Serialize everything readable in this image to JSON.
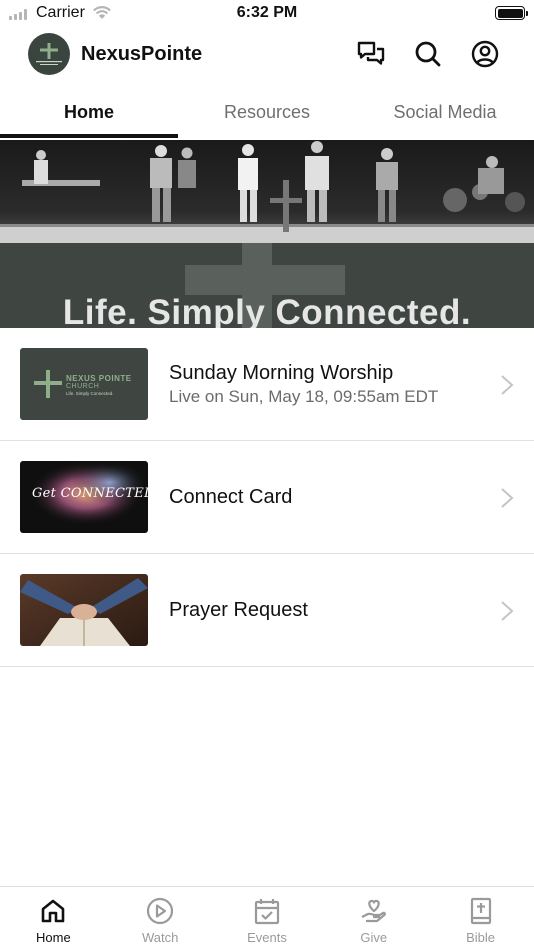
{
  "status_bar": {
    "carrier": "Carrier",
    "time": "6:32 PM"
  },
  "header": {
    "title": "NexusPointe",
    "logo_text": "NEXUS POINTE CHURCH"
  },
  "tabs": [
    {
      "label": "Home",
      "active": true
    },
    {
      "label": "Resources",
      "active": false
    },
    {
      "label": "Social Media",
      "active": false
    }
  ],
  "hero": {
    "tagline": "Life. Simply Connected."
  },
  "list": [
    {
      "title": "Sunday Morning Worship",
      "subtitle": "Live on Sun, May 18, 09:55am EDT",
      "thumb_text": "NEXUS POINTE",
      "thumb_text2": "CHURCH",
      "thumb_text3": "Life. Simply Connected."
    },
    {
      "title": "Connect Card",
      "thumb_text": "Get CONNECTED"
    },
    {
      "title": "Prayer Request"
    }
  ],
  "bottom_nav": [
    {
      "label": "Home",
      "icon": "home-icon",
      "active": true
    },
    {
      "label": "Watch",
      "icon": "play-circle-icon",
      "active": false
    },
    {
      "label": "Events",
      "icon": "calendar-check-icon",
      "active": false
    },
    {
      "label": "Give",
      "icon": "give-heart-hand-icon",
      "active": false
    },
    {
      "label": "Bible",
      "icon": "bible-icon",
      "active": false
    }
  ],
  "colors": {
    "accent": "#111111",
    "inactive": "#9a9a9a",
    "brand_green": "#3f4642",
    "brand_cross": "#8fae8a"
  }
}
